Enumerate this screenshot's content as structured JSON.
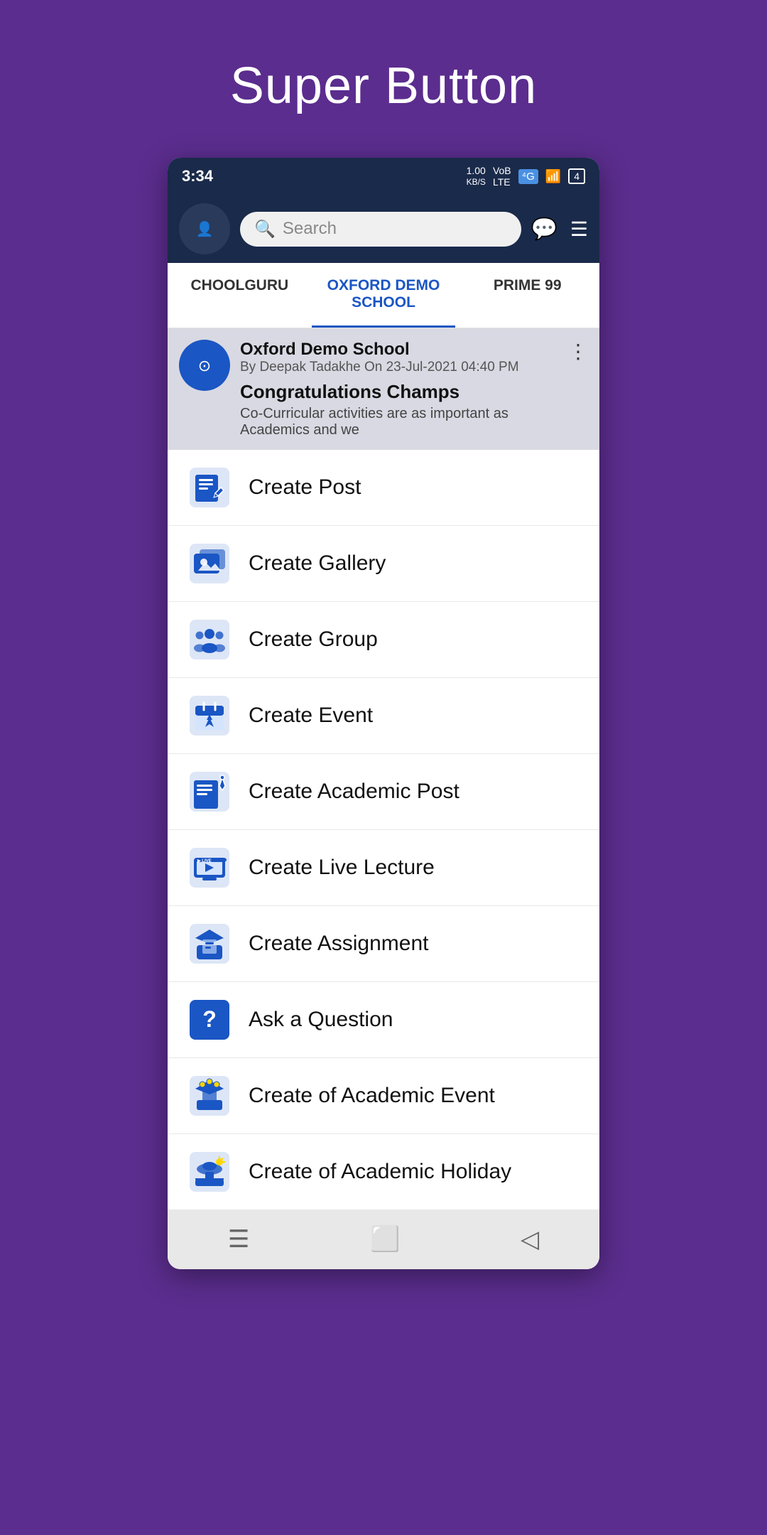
{
  "page": {
    "title": "Super Button"
  },
  "status_bar": {
    "time": "3:34",
    "network": "1.00 KB/S",
    "network2": "VoB LTE",
    "signal": "4G"
  },
  "header": {
    "search_placeholder": "Search"
  },
  "tabs": [
    {
      "label": "CHOOLGURU",
      "active": false
    },
    {
      "label": "OXFORD DEMO SCHOOL",
      "active": true
    },
    {
      "label": "PRIME 99",
      "active": false
    }
  ],
  "feed": {
    "school_name": "Oxford Demo School",
    "meta": "By Deepak Tadakhe On 23-Jul-2021 04:40 PM",
    "post_title": "Congratulations Champs",
    "post_body": "Co-Curricular activities are as important as Academics and we"
  },
  "menu_items": [
    {
      "id": "create-post",
      "label": "Create Post",
      "icon": "post"
    },
    {
      "id": "create-gallery",
      "label": "Create Gallery",
      "icon": "gallery"
    },
    {
      "id": "create-group",
      "label": "Create Group",
      "icon": "group"
    },
    {
      "id": "create-event",
      "label": "Create Event",
      "icon": "event"
    },
    {
      "id": "create-academic-post",
      "label": "Create Academic Post",
      "icon": "academic-post"
    },
    {
      "id": "create-live-lecture",
      "label": "Create Live Lecture",
      "icon": "live-lecture"
    },
    {
      "id": "create-assignment",
      "label": "Create Assignment",
      "icon": "assignment"
    },
    {
      "id": "ask-question",
      "label": "Ask a Question",
      "icon": "question"
    },
    {
      "id": "create-academic-event",
      "label": "Create of Academic Event",
      "icon": "academic-event"
    },
    {
      "id": "create-academic-holiday",
      "label": "Create of Academic Holiday",
      "icon": "academic-holiday"
    }
  ],
  "colors": {
    "icon_blue": "#1a56c4",
    "tab_active": "#1a56c4",
    "bg_purple": "#5b2d8e"
  }
}
